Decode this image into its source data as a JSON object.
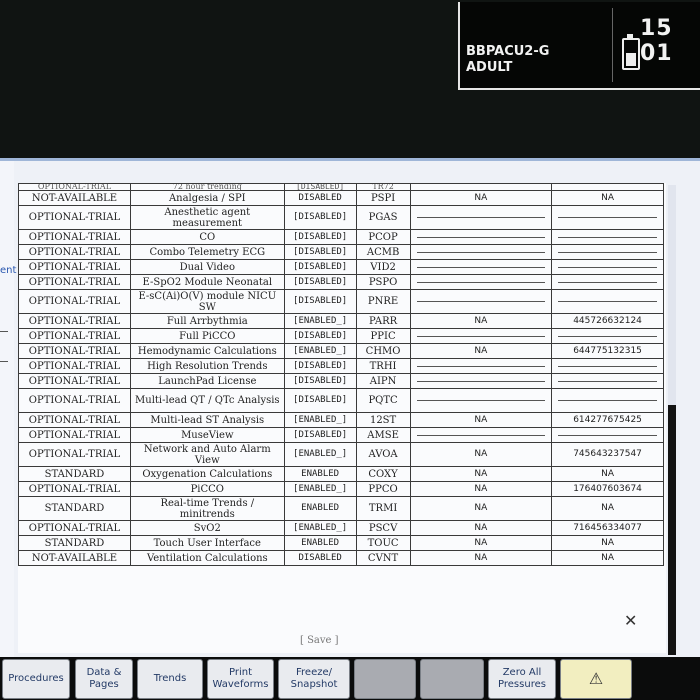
{
  "header": {
    "patient_id": "BBPACU2-G",
    "patient_category": "ADULT",
    "clock": "15 01",
    "battery_level": 0.6
  },
  "left_strip": {
    "fragment": "ent"
  },
  "table": {
    "cut_row": [
      "OPTIONAL-TRIAL",
      "72 hour trending",
      "[DISABLED]",
      "TR72",
      "",
      ""
    ],
    "rows": [
      [
        "NOT-AVAILABLE",
        "Analgesia / SPI",
        "DISABLED",
        "PSPI",
        "NA",
        "NA"
      ],
      [
        "OPTIONAL-TRIAL",
        "Anesthetic agent measurement",
        "[DISABLED]",
        "PGAS",
        "",
        ""
      ],
      [
        "OPTIONAL-TRIAL",
        "CO",
        "[DISABLED]",
        "PCOP",
        "",
        ""
      ],
      [
        "OPTIONAL-TRIAL",
        "Combo Telemetry ECG",
        "[DISABLED]",
        "ACMB",
        "",
        ""
      ],
      [
        "OPTIONAL-TRIAL",
        "Dual Video",
        "[DISABLED]",
        "VID2",
        "",
        ""
      ],
      [
        "OPTIONAL-TRIAL",
        "E-SpO2 Module Neonatal",
        "[DISABLED]",
        "PSPO",
        "",
        ""
      ],
      [
        "OPTIONAL-TRIAL",
        "E-sC(Ai)O(V) module NICU SW",
        "[DISABLED]",
        "PNRE",
        "",
        ""
      ],
      [
        "OPTIONAL-TRIAL",
        "Full Arrbythmia",
        "[ENABLED_]",
        "PARR",
        "NA",
        "445726632124"
      ],
      [
        "OPTIONAL-TRIAL",
        "Full PiCCO",
        "[DISABLED]",
        "PPIC",
        "",
        ""
      ],
      [
        "OPTIONAL-TRIAL",
        "Hemodynamic Calculations",
        "[ENABLED_]",
        "CHMO",
        "NA",
        "644775132315"
      ],
      [
        "OPTIONAL-TRIAL",
        "High Resolution Trends",
        "[DISABLED]",
        "TRHI",
        "",
        ""
      ],
      [
        "OPTIONAL-TRIAL",
        "LaunchPad License",
        "[DISABLED]",
        "AIPN",
        "",
        ""
      ],
      [
        "OPTIONAL-TRIAL",
        "Multi-lead QT / QTc Analysis",
        "[DISABLED]",
        "PQTC",
        "",
        ""
      ],
      [
        "OPTIONAL-TRIAL",
        "Multi-lead ST Analysis",
        "[ENABLED_]",
        "12ST",
        "NA",
        "614277675425"
      ],
      [
        "OPTIONAL-TRIAL",
        "MuseView",
        "[DISABLED]",
        "AMSE",
        "",
        ""
      ],
      [
        "OPTIONAL-TRIAL",
        "Network and Auto Alarm View",
        "[ENABLED_]",
        "AVOA",
        "NA",
        "745643237547"
      ],
      [
        "STANDARD",
        "Oxygenation Calculations",
        "ENABLED",
        "COXY",
        "NA",
        "NA"
      ],
      [
        "OPTIONAL-TRIAL",
        "PiCCO",
        "[ENABLED_]",
        "PPCO",
        "NA",
        "176407603674"
      ],
      [
        "STANDARD",
        "Real-time Trends / minitrends",
        "ENABLED",
        "TRMI",
        "NA",
        "NA"
      ],
      [
        "OPTIONAL-TRIAL",
        "SvO2",
        "[ENABLED_]",
        "PSCV",
        "NA",
        "716456334077"
      ],
      [
        "STANDARD",
        "Touch User Interface",
        "ENABLED",
        "TOUC",
        "NA",
        "NA"
      ],
      [
        "NOT-AVAILABLE",
        "Ventilation Calculations",
        "DISABLED",
        "CVNT",
        "NA",
        "NA"
      ]
    ]
  },
  "save_label": "[ Save ]",
  "softkeys": [
    {
      "label": "Procedures",
      "enabled": true
    },
    {
      "label": "Data & Pages",
      "enabled": true
    },
    {
      "label": "Trends",
      "enabled": true
    },
    {
      "label": "Print Waveforms",
      "enabled": true
    },
    {
      "label": "Freeze/ Snapshot",
      "enabled": true
    },
    {
      "label": "",
      "enabled": false
    },
    {
      "label": "",
      "enabled": false
    },
    {
      "label": "Zero All Pressures",
      "enabled": true
    },
    {
      "label": "",
      "enabled": true,
      "icon": "alarm-bell-icon"
    }
  ]
}
